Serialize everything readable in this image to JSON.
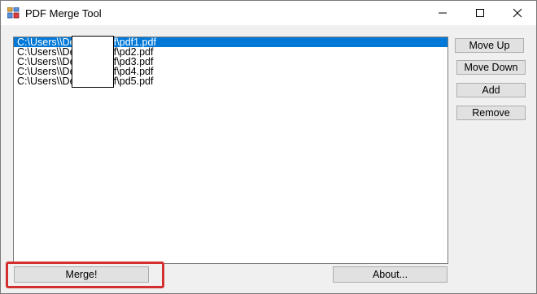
{
  "window": {
    "title": "PDF Merge Tool",
    "icon": "pdf-merge-app-icon",
    "controls": {
      "minimize": "minimize-icon",
      "maximize": "maximize-icon",
      "close": "close-icon"
    }
  },
  "file_list": {
    "items": [
      {
        "path": "C:\\Users\\\\Desktop\\pdf\\pdf1.pdf",
        "selected": true
      },
      {
        "path": "C:\\Users\\\\Desktop\\pdf\\pd2.pdf",
        "selected": false
      },
      {
        "path": "C:\\Users\\\\Desktop\\pdf\\pd3.pdf",
        "selected": false
      },
      {
        "path": "C:\\Users\\\\Desktop\\pdf\\pd4.pdf",
        "selected": false
      },
      {
        "path": "C:\\Users\\\\Desktop\\pdf\\pd5.pdf",
        "selected": false
      }
    ]
  },
  "buttons": {
    "move_up": "Move Up",
    "move_down": "Move Down",
    "add": "Add",
    "remove": "Remove",
    "merge": "Merge!",
    "about": "About..."
  },
  "colors": {
    "selection": "#0078d7",
    "highlight_box": "#d32f2f",
    "window_bg": "#f0f0f0",
    "button_bg": "#e1e1e1"
  }
}
